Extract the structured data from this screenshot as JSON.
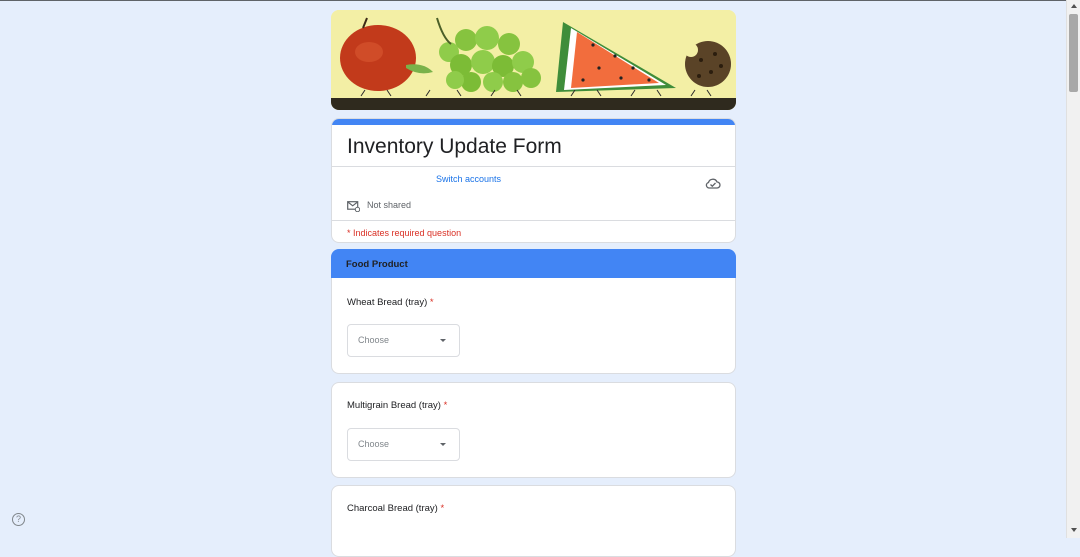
{
  "form": {
    "title": "Inventory Update Form",
    "switch_accounts": "Switch accounts",
    "not_shared": "Not shared",
    "required_note": "* Indicates required question"
  },
  "section": {
    "title": "Food Product"
  },
  "questions": [
    {
      "label": "Wheat Bread (tray)",
      "required_mark": "*",
      "placeholder": "Choose"
    },
    {
      "label": "Multigrain Bread (tray)",
      "required_mark": "*",
      "placeholder": "Choose"
    },
    {
      "label": "Charcoal Bread (tray)",
      "required_mark": "*"
    }
  ],
  "help": {
    "glyph": "?"
  },
  "icons": [
    "cloud-check-icon",
    "mail-icon",
    "help-icon",
    "chevron-down-icon"
  ],
  "colors": {
    "accent": "#4285f4",
    "background": "#e5eefc",
    "link": "#1a73e8",
    "required": "#d93025"
  }
}
